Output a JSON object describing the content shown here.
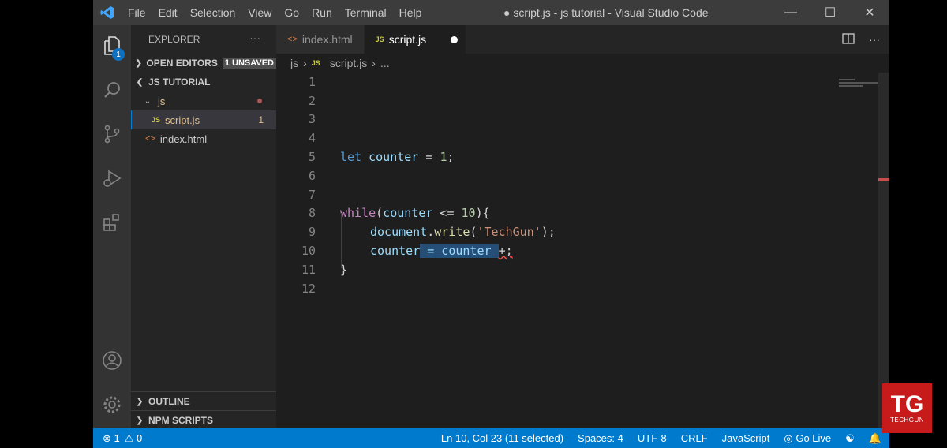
{
  "titlebar": {
    "menu": [
      "File",
      "Edit",
      "Selection",
      "View",
      "Go",
      "Run",
      "Terminal",
      "Help"
    ],
    "title": "● script.js - js tutorial - Visual Studio Code"
  },
  "activity": {
    "explorer_badge": "1"
  },
  "sidebar": {
    "header": "EXPLORER",
    "header_more": "···",
    "open_editors": "OPEN EDITORS",
    "unsaved_badge": "1 UNSAVED",
    "folder": "JS TUTORIAL",
    "tree": {
      "js_folder": "js",
      "script_file": "script.js",
      "script_problems": "1",
      "index_file": "index.html"
    },
    "outline": "OUTLINE",
    "npm_scripts": "NPM SCRIPTS"
  },
  "tabs": [
    {
      "label": "index.html"
    },
    {
      "label": "script.js"
    }
  ],
  "breadcrumb": {
    "folder": "js",
    "file": "script.js",
    "more": "..."
  },
  "code_lines": [
    "1",
    "2",
    "3",
    "4",
    "5",
    "6",
    "7",
    "8",
    "9",
    "10",
    "11",
    "12"
  ],
  "code": {
    "l5_kw": "let",
    "l5_var": "counter",
    "l5_rest": " = ",
    "l5_num": "1",
    "l5_end": ";",
    "l8_kw": "while",
    "l8_a": "(",
    "l8_var": "counter",
    "l8_op": " <= ",
    "l8_num": "10",
    "l8_end": "){",
    "l9_obj": "document",
    "l9_dot": ".",
    "l9_fn": "write",
    "l9_p1": "(",
    "l9_str": "'TechGun'",
    "l9_p2": ");",
    "l10_var": "counter",
    "l10_sel": " = counter ",
    "l10_tail": "+;",
    "l11": "}"
  },
  "status": {
    "errors": "⊗ 1",
    "warnings": "⚠ 0",
    "position": "Ln 10, Col 23 (11 selected)",
    "spaces": "Spaces: 4",
    "encoding": "UTF-8",
    "eol": "CRLF",
    "language": "JavaScript",
    "golive": "Go Live"
  },
  "watermark": {
    "big": "TG",
    "small": "TECHGUN"
  },
  "colors": {
    "status_bar": "#007acc",
    "accent": "#0e70c0",
    "watermark": "#c71a1a"
  }
}
